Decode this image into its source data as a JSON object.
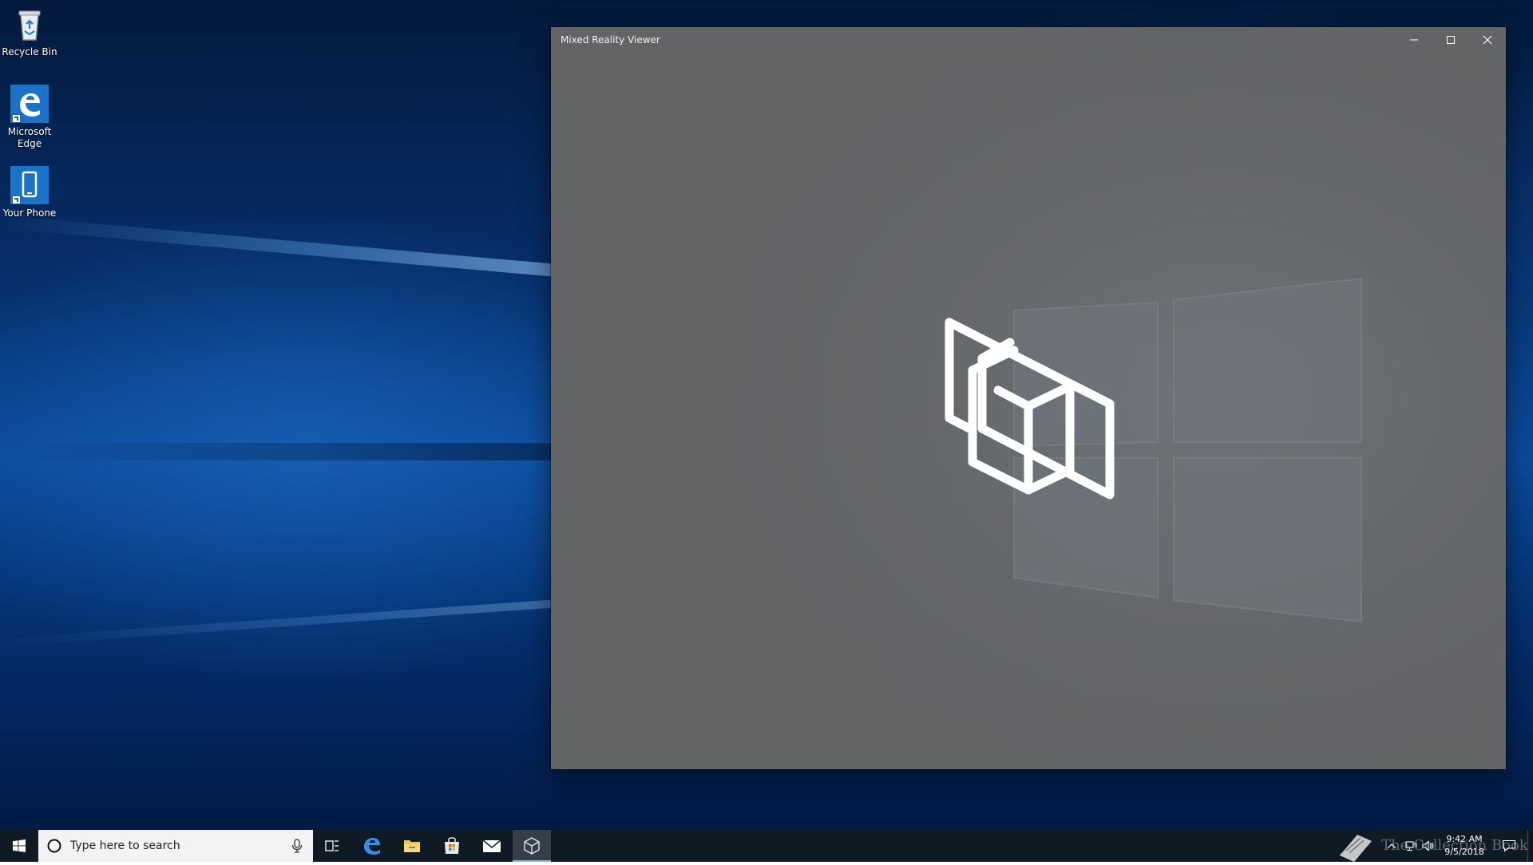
{
  "desktop": {
    "icons": [
      {
        "label": "Recycle Bin"
      },
      {
        "label": "Microsoft\nEdge"
      },
      {
        "label": "Your Phone"
      }
    ]
  },
  "window": {
    "title": "Mixed Reality Viewer",
    "background_color": "#626466",
    "logo_icon": "mixed-reality-cube-icon"
  },
  "taskbar": {
    "search_placeholder": "Type here to search",
    "pinned": [
      "task-view-icon",
      "edge-icon",
      "file-explorer-icon",
      "store-icon",
      "mail-icon",
      "mixed-reality-viewer-icon"
    ],
    "active_app": "mixed-reality-viewer-icon",
    "watermark": "The Collection Book",
    "time": "9:42 AM",
    "date": "9/5/2018"
  },
  "colors": {
    "taskbar": "#101a24",
    "accent": "#76b9ed",
    "edge_blue": "#1a73c8"
  }
}
